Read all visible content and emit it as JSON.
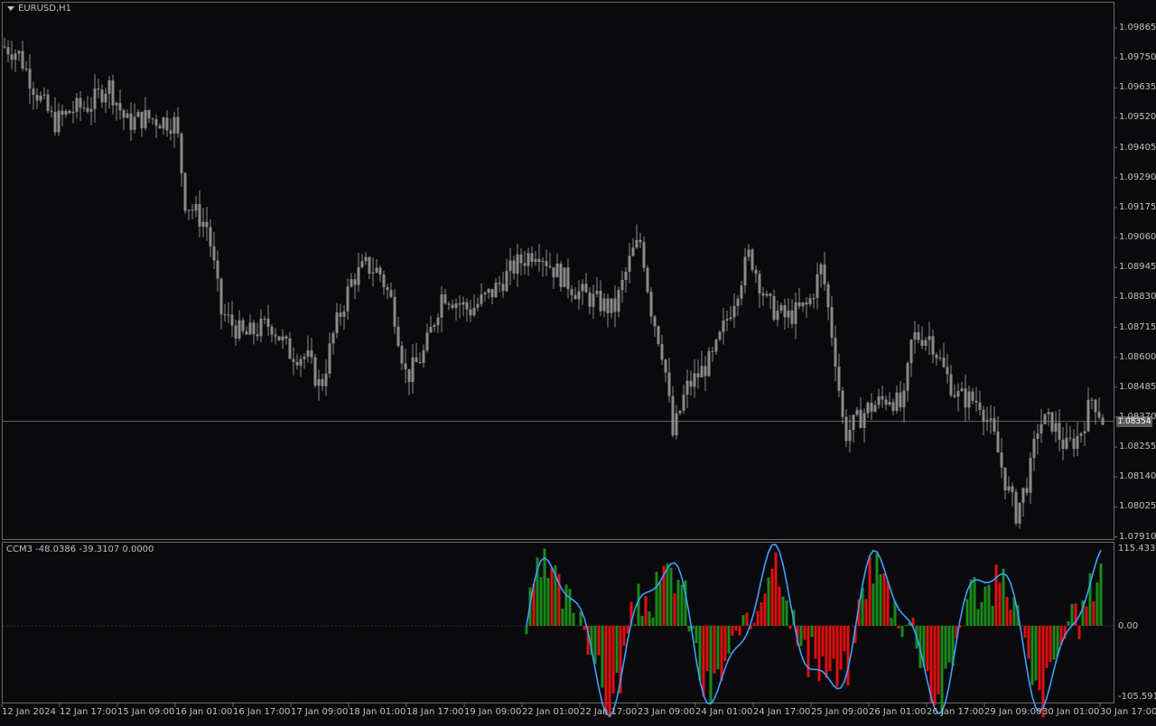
{
  "window": {
    "symbol_label": "EURUSD,H1"
  },
  "indicator": {
    "label": "CCM3 -48.0386 -39.3107 0.0000",
    "axis_top": "115.4334",
    "axis_zero": "0.00",
    "axis_bottom": "-105.5916"
  },
  "price_axis": {
    "ticks": [
      "1.09865",
      "1.09750",
      "1.09635",
      "1.09520",
      "1.09405",
      "1.09290",
      "1.09175",
      "1.09060",
      "1.08945",
      "1.08830",
      "1.08715",
      "1.08600",
      "1.08485",
      "1.08370",
      "1.08255",
      "1.08140",
      "1.08025",
      "1.07910"
    ],
    "current_price": "1.08354"
  },
  "time_axis": {
    "labels": [
      "12 Jan 2024",
      "12 Jan 17:00",
      "15 Jan 09:00",
      "16 Jan 01:00",
      "16 Jan 17:00",
      "17 Jan 09:00",
      "18 Jan 01:00",
      "18 Jan 17:00",
      "19 Jan 09:00",
      "22 Jan 01:00",
      "22 Jan 17:00",
      "23 Jan 09:00",
      "24 Jan 01:00",
      "24 Jan 17:00",
      "25 Jan 09:00",
      "26 Jan 01:00",
      "26 Jan 17:00",
      "29 Jan 09:00",
      "30 Jan 01:00",
      "30 Jan 17:00"
    ]
  },
  "colors": {
    "background": "#0a0a0d",
    "candle": "#8a8a8a",
    "frame": "#6a6a6a",
    "hist_up": "#1a8a1a",
    "hist_down": "#e01010",
    "signal_line": "#3fa0ff"
  },
  "chart_data": {
    "type": "candlestick",
    "symbol": "EURUSD",
    "timeframe": "H1",
    "ylim": [
      1.0791,
      1.0992
    ],
    "close_path": [
      [
        0,
        1.098
      ],
      [
        20,
        1.0977
      ],
      [
        40,
        1.0962
      ],
      [
        60,
        1.095
      ],
      [
        80,
        1.0955
      ],
      [
        100,
        1.0957
      ],
      [
        120,
        1.0965
      ],
      [
        140,
        1.095
      ],
      [
        160,
        1.0952
      ],
      [
        180,
        1.0951
      ],
      [
        195,
        1.095
      ],
      [
        205,
        1.092
      ],
      [
        230,
        1.091
      ],
      [
        245,
        1.0877
      ],
      [
        270,
        1.0868
      ],
      [
        300,
        1.0873
      ],
      [
        320,
        1.0862
      ],
      [
        340,
        1.086
      ],
      [
        355,
        1.0848
      ],
      [
        370,
        1.087
      ],
      [
        390,
        1.089
      ],
      [
        405,
        1.0895
      ],
      [
        420,
        1.0893
      ],
      [
        435,
        1.088
      ],
      [
        450,
        1.0852
      ],
      [
        470,
        1.0862
      ],
      [
        490,
        1.0885
      ],
      [
        520,
        1.0878
      ],
      [
        545,
        1.0885
      ],
      [
        570,
        1.0895
      ],
      [
        595,
        1.0902
      ],
      [
        610,
        1.0895
      ],
      [
        640,
        1.0885
      ],
      [
        680,
        1.0878
      ],
      [
        700,
        1.09
      ],
      [
        710,
        1.0905
      ],
      [
        720,
        1.088
      ],
      [
        735,
        1.086
      ],
      [
        745,
        1.083
      ],
      [
        760,
        1.0848
      ],
      [
        790,
        1.086
      ],
      [
        810,
        1.088
      ],
      [
        830,
        1.09
      ],
      [
        850,
        1.088
      ],
      [
        870,
        1.0875
      ],
      [
        895,
        1.088
      ],
      [
        910,
        1.0895
      ],
      [
        925,
        1.086
      ],
      [
        935,
        1.083
      ],
      [
        960,
        1.084
      ],
      [
        985,
        1.0845
      ],
      [
        1000,
        1.084
      ],
      [
        1010,
        1.0868
      ],
      [
        1030,
        1.0868
      ],
      [
        1045,
        1.0855
      ],
      [
        1060,
        1.0845
      ],
      [
        1085,
        1.0843
      ],
      [
        1100,
        1.083
      ],
      [
        1115,
        1.081
      ],
      [
        1125,
        1.08
      ],
      [
        1140,
        1.0815
      ],
      [
        1150,
        1.0835
      ],
      [
        1165,
        1.0835
      ],
      [
        1180,
        1.0825
      ],
      [
        1195,
        1.083
      ],
      [
        1210,
        1.0845
      ],
      [
        1222,
        1.0835
      ]
    ],
    "indicator": {
      "name": "CCM3",
      "values": [
        -48.0386,
        -39.3107,
        0.0
      ],
      "ylim": [
        -105.5916,
        115.4334
      ]
    }
  }
}
